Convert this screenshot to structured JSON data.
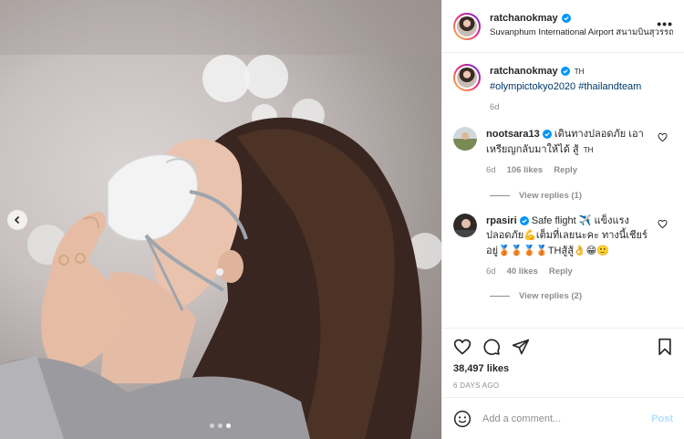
{
  "header": {
    "username": "ratchanokmay",
    "location": "Suvanphum International Airport สนามบินสุวรรณภูมิ",
    "more_icon": "more-horizontal-icon"
  },
  "caption": {
    "username": "ratchanokmay",
    "lang_tag": "TH",
    "hashtag1": "#olympictokyo2020",
    "hashtag2": "#thailandteam",
    "age": "6d"
  },
  "comments": [
    {
      "username": "nootsara13",
      "text": "เดินทางปลอดภัย เอาเหรียญกลับมาให้ได้ สู้",
      "lang_tag": "TH",
      "age": "6d",
      "likes": "106 likes",
      "reply": "Reply",
      "view_replies": "View replies (1)"
    },
    {
      "username": "rpasiri",
      "text": "Safe flight ✈️ แข็งแรงปลอดภัย💪เต็มที่เลยนะคะ ทางนี้เชียร์อยู่🥉🥉🥉🥉THสู้สู้👌😁🙂",
      "age": "6d",
      "likes": "40 likes",
      "reply": "Reply",
      "view_replies": "View replies (2)"
    }
  ],
  "actions": {
    "likes": "38,497 likes",
    "date": "6 DAYS AGO"
  },
  "add_comment": {
    "placeholder": "Add a comment...",
    "post_label": "Post"
  },
  "colors": {
    "accent": "#0095f6",
    "post_disabled": "#b2dffc",
    "hashtag": "#00376b",
    "meta_grey": "#8e8e8e"
  }
}
